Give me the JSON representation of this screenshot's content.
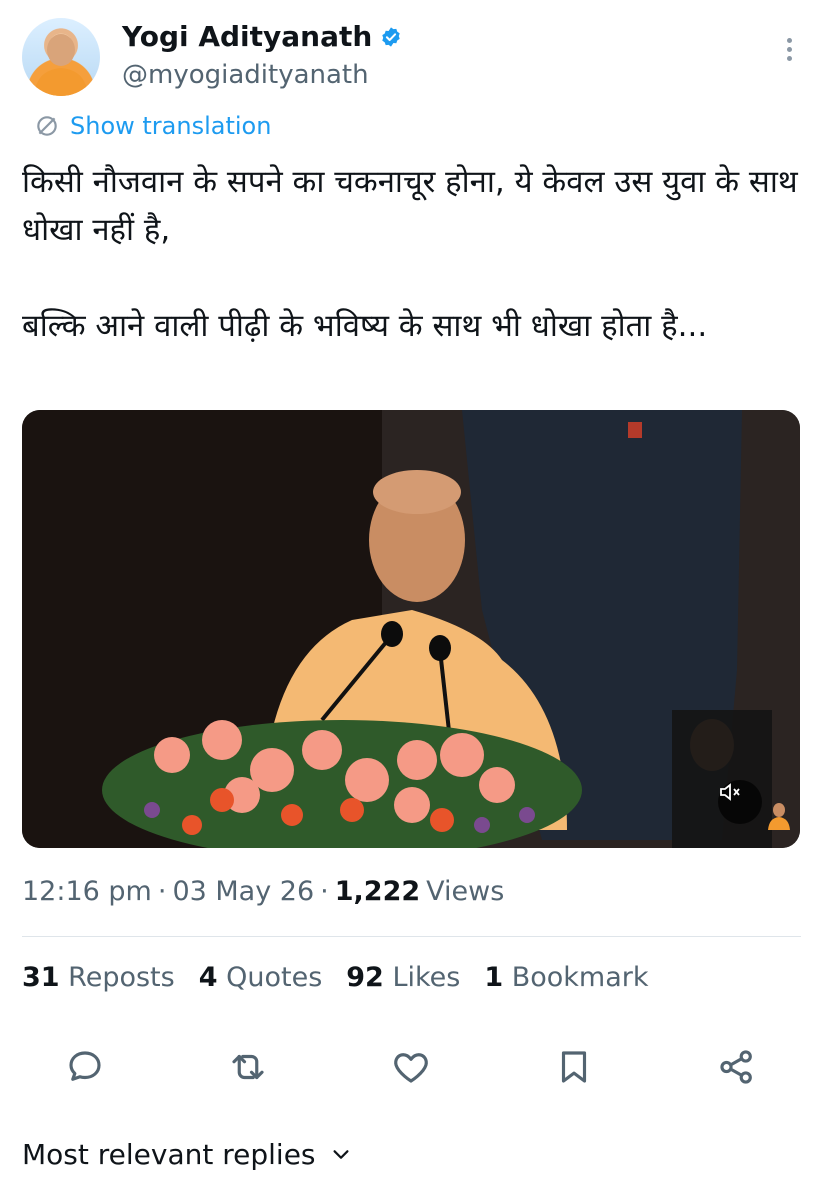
{
  "author": {
    "name": "Yogi Adityanath",
    "handle": "@myogiadityanath",
    "verified": true,
    "avatar_icon": "profile-photo"
  },
  "translate_label": "Show translation",
  "tweet": {
    "text": "किसी नौजवान के सपने का चकनाचूर होना, ये केवल उस युवा के साथ धोखा नहीं है,\n\nबल्कि आने वाली पीढ़ी के भविष्य के साथ भी धोखा होता है..."
  },
  "meta": {
    "time": "12:16 pm",
    "date": "03 May 26",
    "views_count": "1,222",
    "views_label": "Views",
    "separator": "·"
  },
  "stats": {
    "reposts_count": "31",
    "reposts_label": "Reposts",
    "quotes_count": "4",
    "quotes_label": "Quotes",
    "likes_count": "92",
    "likes_label": "Likes",
    "bookmarks_count": "1",
    "bookmarks_label": "Bookmark"
  },
  "actions": [
    "reply-icon",
    "repost-icon",
    "like-icon",
    "bookmark-icon",
    "share-icon"
  ],
  "replies_sort_label": "Most relevant replies",
  "colors": {
    "accent": "#1d9bf0",
    "secondary_text": "#536471",
    "primary_text": "#0f1419"
  }
}
